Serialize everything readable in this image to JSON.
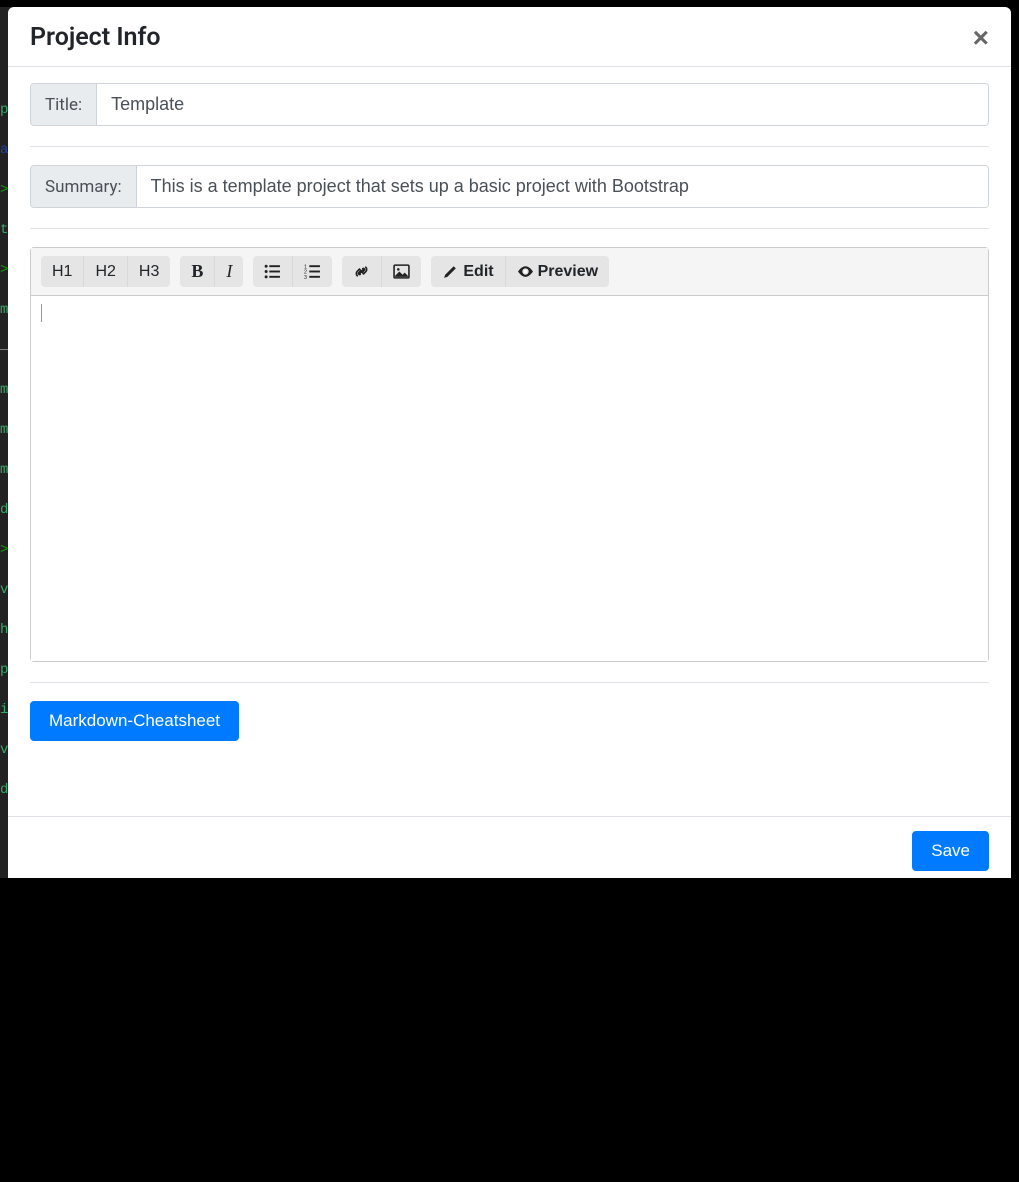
{
  "modal": {
    "title": "Project Info",
    "close_label": "×"
  },
  "fields": {
    "title_label": "Title:",
    "title_value": "Template",
    "summary_label": "Summary:",
    "summary_value": "This is a template project that sets up a basic project with Bootstrap"
  },
  "toolbar": {
    "h1": "H1",
    "h2": "H2",
    "h3": "H3",
    "bold": "B",
    "italic": "I",
    "edit": "Edit",
    "preview": "Preview"
  },
  "editor": {
    "content": ""
  },
  "actions": {
    "cheatsheet": "Markdown-Cheatsheet",
    "save": "Save"
  }
}
